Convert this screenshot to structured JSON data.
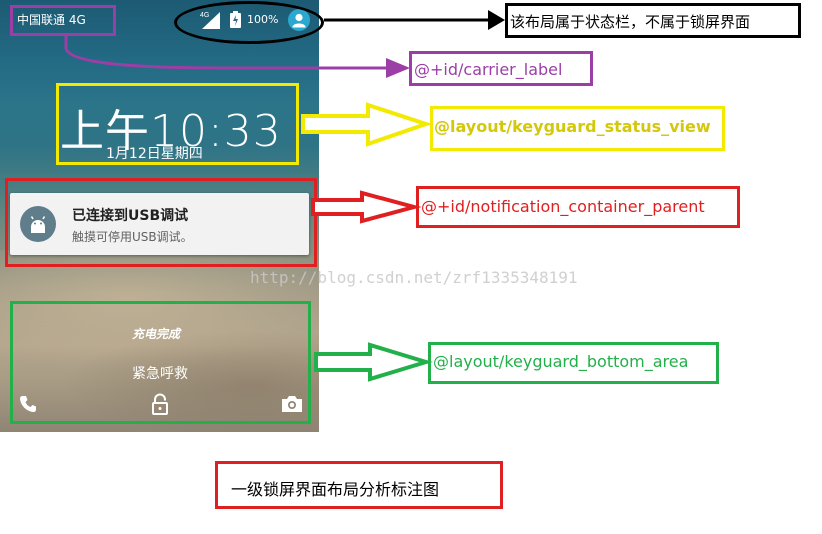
{
  "lockscreen": {
    "status_bar": {
      "carrier": "中国联通 4G",
      "network_type": "4G",
      "battery_percent": "100%"
    },
    "clock": {
      "time": "上午10:33",
      "date": "1月12日星期四"
    },
    "notification": {
      "title": "已连接到USB调试",
      "text": "触摸可停用USB调试。"
    },
    "bottom_area": {
      "charging_text": "充电完成",
      "emergency_call": "紧急呼救"
    }
  },
  "annotations": [
    {
      "id": "status-bar-note",
      "label": "该布局属于状态栏，不属于锁屏界面",
      "color": "#000000"
    },
    {
      "id": "carrier-label-note",
      "label": "@+id/carrier_label",
      "color": "#9b3fa6"
    },
    {
      "id": "status-view-note",
      "label": "@layout/keyguard_status_view",
      "color": "#d4c80c"
    },
    {
      "id": "notification-note",
      "label": "@+id/notification_container_parent",
      "color": "#e02020"
    },
    {
      "id": "bottom-area-note",
      "label": "@layout/keyguard_bottom_area",
      "color": "#22b04a"
    }
  ],
  "caption": "一级锁屏界面布局分析标注图",
  "watermark": "http://blog.csdn.net/zrf1335348191",
  "icons": [
    "signal-icon",
    "battery-icon",
    "user-avatar-icon",
    "android-icon",
    "phone-icon",
    "lock-icon",
    "camera-icon"
  ],
  "colors": {
    "black": "#000000",
    "purple": "#9b3fa6",
    "yellow": "#f2ea00",
    "red": "#e02020",
    "green": "#22b04a"
  }
}
